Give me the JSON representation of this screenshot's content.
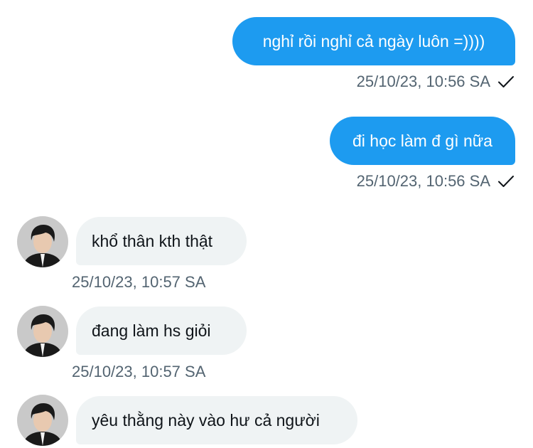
{
  "messages": [
    {
      "direction": "out",
      "text": "nghỉ rồi nghỉ cả ngày luôn =))))",
      "time": "25/10/23, 10:56 SA",
      "status_icon": "check-icon"
    },
    {
      "direction": "out",
      "text": "đi học làm đ gì nữa",
      "time": "25/10/23, 10:56 SA",
      "status_icon": "check-icon"
    },
    {
      "direction": "in",
      "text": "khổ thân kth thật",
      "time": "25/10/23, 10:57 SA",
      "avatar_icon": "user-avatar"
    },
    {
      "direction": "in",
      "text": "đang làm hs giỏi",
      "time": "25/10/23, 10:57 SA",
      "avatar_icon": "user-avatar"
    },
    {
      "direction": "in",
      "text": "yêu thằng này vào hư cả người",
      "avatar_icon": "user-avatar"
    }
  ],
  "colors": {
    "outgoing_bubble": "#1d9bf0",
    "incoming_bubble": "#eff3f4",
    "timestamp": "#536471"
  }
}
